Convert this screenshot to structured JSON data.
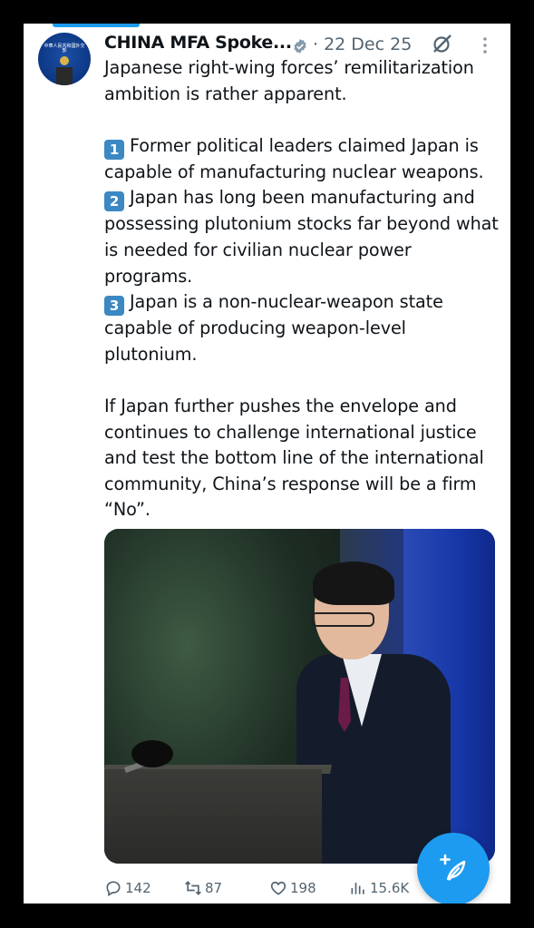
{
  "header": {
    "name": "CHINA MFA Spoke...",
    "date": "· 22 Dec 25"
  },
  "avatar": {
    "text": "中華人民共和國外交部"
  },
  "tweet": {
    "intro": "Japanese right-wing forces’ remilitarization ambition is rather apparent.",
    "points": [
      {
        "badge": "1",
        "text": "Former political leaders claimed Japan is capable of manufacturing nuclear weapons."
      },
      {
        "badge": "2",
        "text": "Japan has long been manufacturing and possessing plutonium stocks far beyond what is needed for civilian nuclear power programs."
      },
      {
        "badge": "3",
        "text": "Japan is a non-nuclear-weapon state capable of producing weapon-level plutonium."
      }
    ],
    "closing": "If Japan further pushes the envelope and continues to challenge international justice and test the bottom line of the international community, China’s response will be a firm “No”."
  },
  "actions": {
    "replies": "142",
    "reposts": "87",
    "likes": "198",
    "views": "15.6K"
  },
  "colors": {
    "accent": "#1d9bf0",
    "text": "#0f1419",
    "muted": "#536471",
    "keycap": "#3b88c3"
  },
  "icons": [
    "verified-badge-icon",
    "grok-icon",
    "more-options-icon",
    "reply-icon",
    "repost-icon",
    "like-icon",
    "views-icon",
    "compose-post-icon"
  ]
}
